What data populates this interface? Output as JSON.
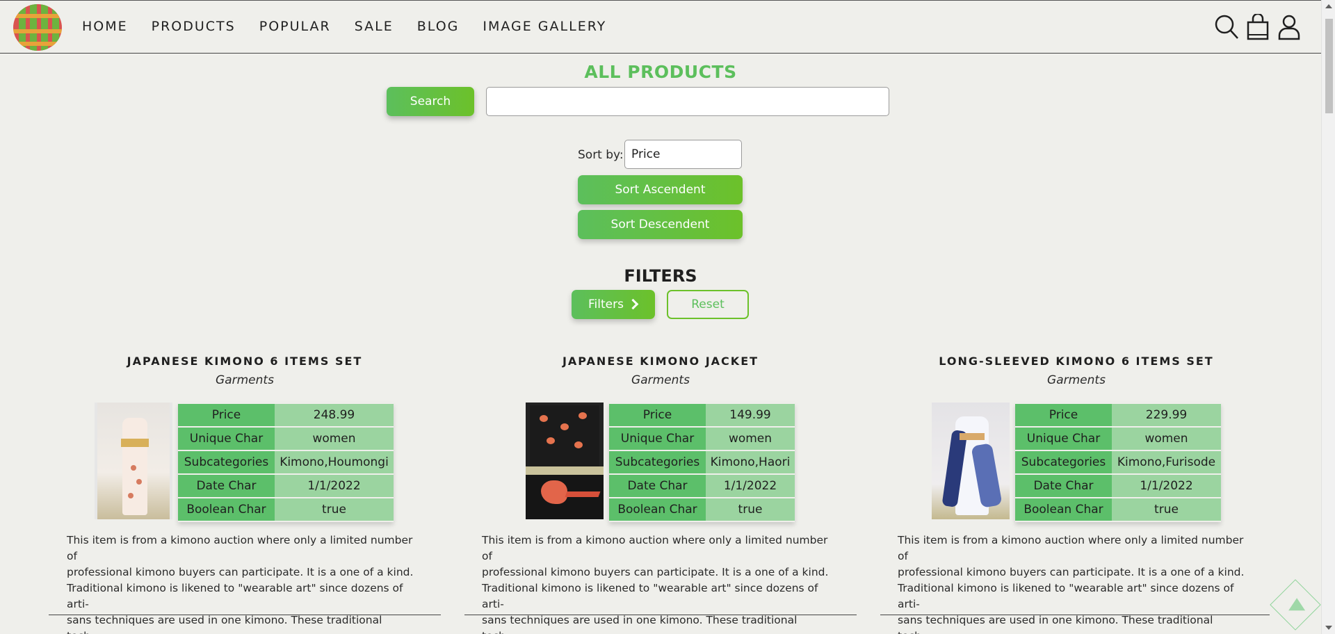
{
  "nav": {
    "items": [
      "HOME",
      "PRODUCTS",
      "POPULAR",
      "SALE",
      "BLOG",
      "IMAGE GALLERY"
    ]
  },
  "header_icons": [
    "search-icon",
    "shopping-bag-icon",
    "user-icon"
  ],
  "page": {
    "title": "ALL PRODUCTS",
    "search_label": "Search",
    "search_value": "",
    "sort_label": "Sort by:",
    "sort_value": "Price",
    "sort_asc": "Sort Ascendent",
    "sort_desc": "Sort Descendent",
    "filters_title": "FILTERS",
    "filters_button": "Filters",
    "reset_button": "Reset"
  },
  "colors": {
    "accent": "#5cbf5c",
    "accent_gradient_end": "#6cc12a",
    "table_key": "#5cbf6a",
    "table_value": "#9bd4a0",
    "background": "#efefeb"
  },
  "table_keys": [
    "Price",
    "Unique Char",
    "Subcategories",
    "Date Char",
    "Boolean Char"
  ],
  "products": [
    {
      "title": "JAPANESE KIMONO 6 ITEMS SET",
      "category": "Garments",
      "values": [
        "248.99",
        "women",
        "Kimono,Houmongi",
        "1/1/2022",
        "true"
      ],
      "desc_lines": [
        "This item is from a kimono auction where only a limited number of",
        "professional kimono buyers can participate. It is a one of a kind.",
        "Traditional kimono is likened to \"wearable art\" since dozens of arti-",
        "sans techniques are used in one kimono. These traditional tech-..."
      ]
    },
    {
      "title": "JAPANESE KIMONO JACKET",
      "category": "Garments",
      "values": [
        "149.99",
        "women",
        "Kimono,Haori",
        "1/1/2022",
        "true"
      ],
      "desc_lines": [
        "This item is from a kimono auction where only a limited number of",
        "professional kimono buyers can participate. It is a one of a kind.",
        "Traditional kimono is likened to \"wearable art\" since dozens of arti-",
        "sans techniques are used in one kimono. These traditional tech-..."
      ]
    },
    {
      "title": "LONG-SLEEVED KIMONO 6 ITEMS SET",
      "category": "Garments",
      "values": [
        "229.99",
        "women",
        "Kimono,Furisode",
        "1/1/2022",
        "true"
      ],
      "desc_lines": [
        "This item is from a kimono auction where only a limited number of",
        "professional kimono buyers can participate. It is a one of a kind.",
        "Traditional kimono is likened to \"wearable art\" since dozens of arti-",
        "sans techniques are used in one kimono. These traditional tech-..."
      ]
    }
  ]
}
